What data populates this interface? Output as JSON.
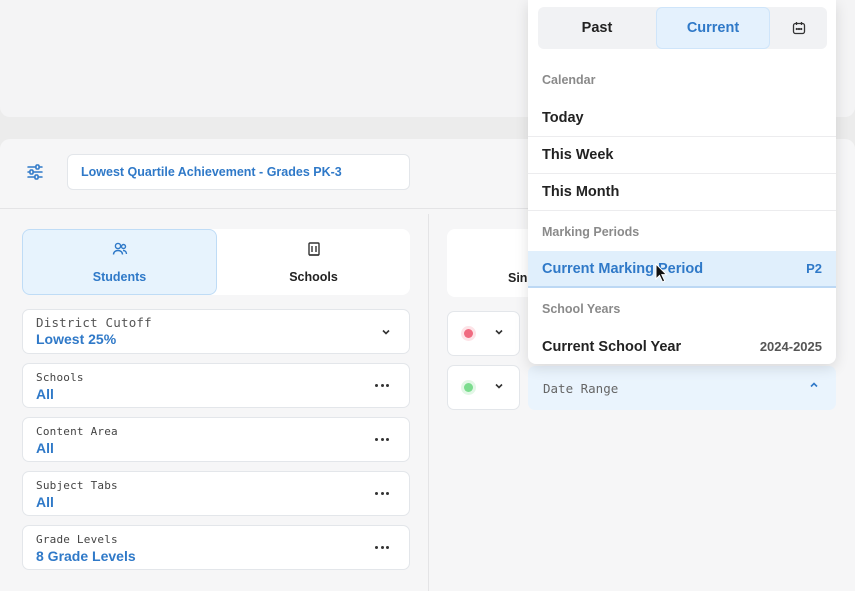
{
  "header": {
    "title": "Lowest Quartile Achievement - Grades PK-3"
  },
  "view_toggle": {
    "students_label": "Students",
    "schools_label": "Schools",
    "active": "Students"
  },
  "filters": [
    {
      "label": "District Cutoff",
      "value": "Lowest 25%",
      "control": "chevron"
    },
    {
      "label": "Schools",
      "value": "All",
      "control": "more"
    },
    {
      "label": "Content Area",
      "value": "All",
      "control": "more"
    },
    {
      "label": "Subject Tabs",
      "value": "All",
      "control": "more"
    },
    {
      "label": "Grade Levels",
      "value": "8 Grade Levels",
      "control": "more"
    }
  ],
  "right_panel": {
    "partial_label": "Sing",
    "status_rows": [
      {
        "color": "#f06b80"
      },
      {
        "color": "#7bdc8e"
      }
    ],
    "date_range_label": "Date Range"
  },
  "date_dropdown": {
    "segments": {
      "past": "Past",
      "current": "Current",
      "calendar_icon": "calendar-icon"
    },
    "active_segment": "Current",
    "sections": {
      "calendar": "Calendar",
      "marking_periods": "Marking Periods",
      "school_years": "School Years"
    },
    "items": {
      "today": "Today",
      "this_week": "This Week",
      "this_month": "This Month",
      "current_marking_period": "Current Marking Period",
      "current_marking_period_extra": "P2",
      "current_school_year": "Current School Year",
      "current_school_year_extra": "2024-2025"
    }
  },
  "colors": {
    "accent": "#2f79c8",
    "active_bg": "#e7f3fd"
  }
}
